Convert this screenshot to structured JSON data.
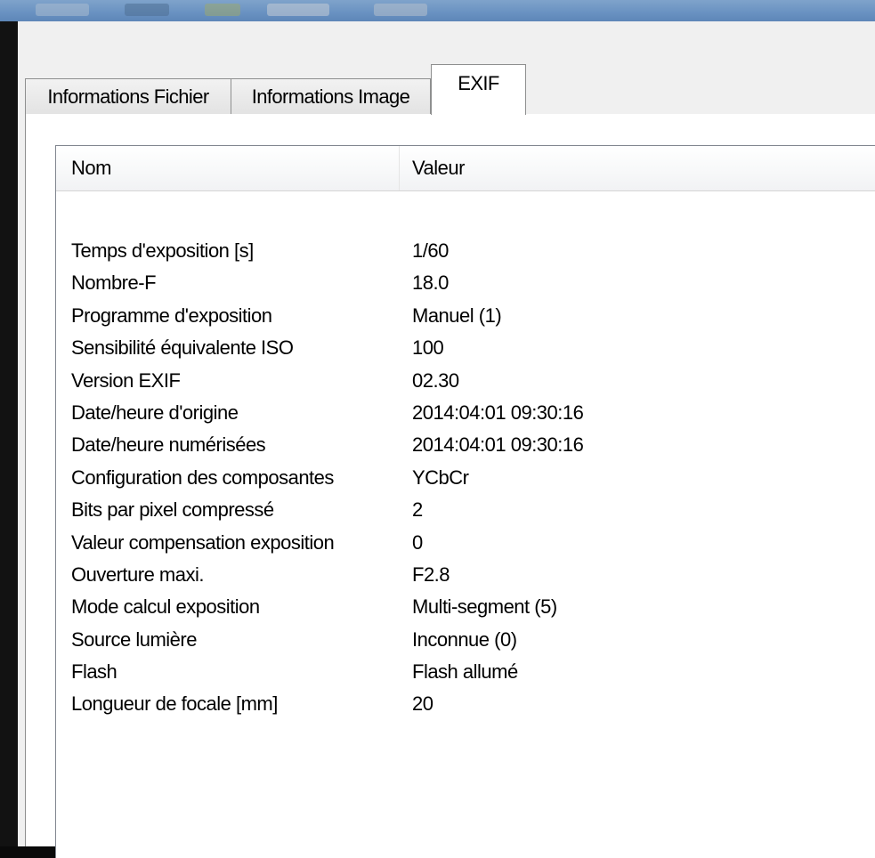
{
  "tabs": [
    {
      "label": "Informations Fichier",
      "active": false
    },
    {
      "label": "Informations Image",
      "active": false
    },
    {
      "label": "EXIF",
      "active": true
    }
  ],
  "list": {
    "columns": {
      "name": "Nom",
      "value": "Valeur"
    },
    "rows": [
      {
        "name": "Temps d'exposition [s]",
        "value": "1/60"
      },
      {
        "name": "Nombre-F",
        "value": "18.0"
      },
      {
        "name": "Programme d'exposition",
        "value": "Manuel (1)"
      },
      {
        "name": "Sensibilité équivalente ISO",
        "value": "100"
      },
      {
        "name": "Version EXIF",
        "value": "02.30"
      },
      {
        "name": "Date/heure d'origine",
        "value": "2014:04:01 09:30:16"
      },
      {
        "name": "Date/heure numérisées",
        "value": "2014:04:01 09:30:16"
      },
      {
        "name": "Configuration des composantes",
        "value": "YCbCr"
      },
      {
        "name": "Bits par pixel compressé",
        "value": "2"
      },
      {
        "name": "Valeur compensation exposition",
        "value": "0"
      },
      {
        "name": "Ouverture maxi.",
        "value": "F2.8"
      },
      {
        "name": "Mode calcul exposition",
        "value": "Multi-segment (5)"
      },
      {
        "name": "Source lumière",
        "value": "Inconnue (0)"
      },
      {
        "name": "Flash",
        "value": "Flash allumé"
      },
      {
        "name": "Longueur de focale [mm]",
        "value": "20"
      }
    ]
  },
  "colors": {
    "titlebar": "#6b93c2",
    "panel": "#f0f0f0",
    "border": "#8e8f8f"
  }
}
